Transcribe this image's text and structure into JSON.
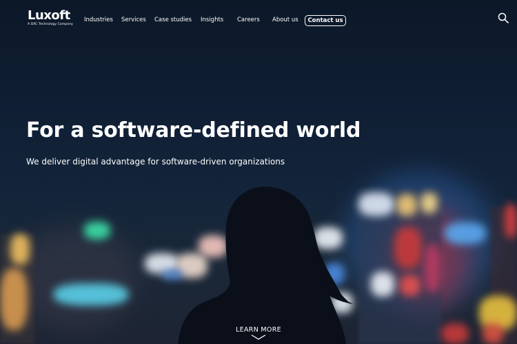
{
  "header": {
    "logo": {
      "wordmark": "Luxoft",
      "tagline": "A DXC Technology Company"
    },
    "nav": [
      {
        "label": "Industries"
      },
      {
        "label": "Services"
      },
      {
        "label": "Case studies"
      },
      {
        "label": "Insights"
      },
      {
        "label": "Careers"
      },
      {
        "label": "About us"
      }
    ],
    "contact_label": "Contact us",
    "search_icon": "search-icon"
  },
  "hero": {
    "title": "For a software-defined world",
    "subtitle": "We deliver digital advantage for software-driven organizations",
    "cta_label": "LEARN MORE",
    "cta_icon": "chevron-down-icon"
  },
  "colors": {
    "text": "#ffffff",
    "background": "#0f1e33"
  }
}
